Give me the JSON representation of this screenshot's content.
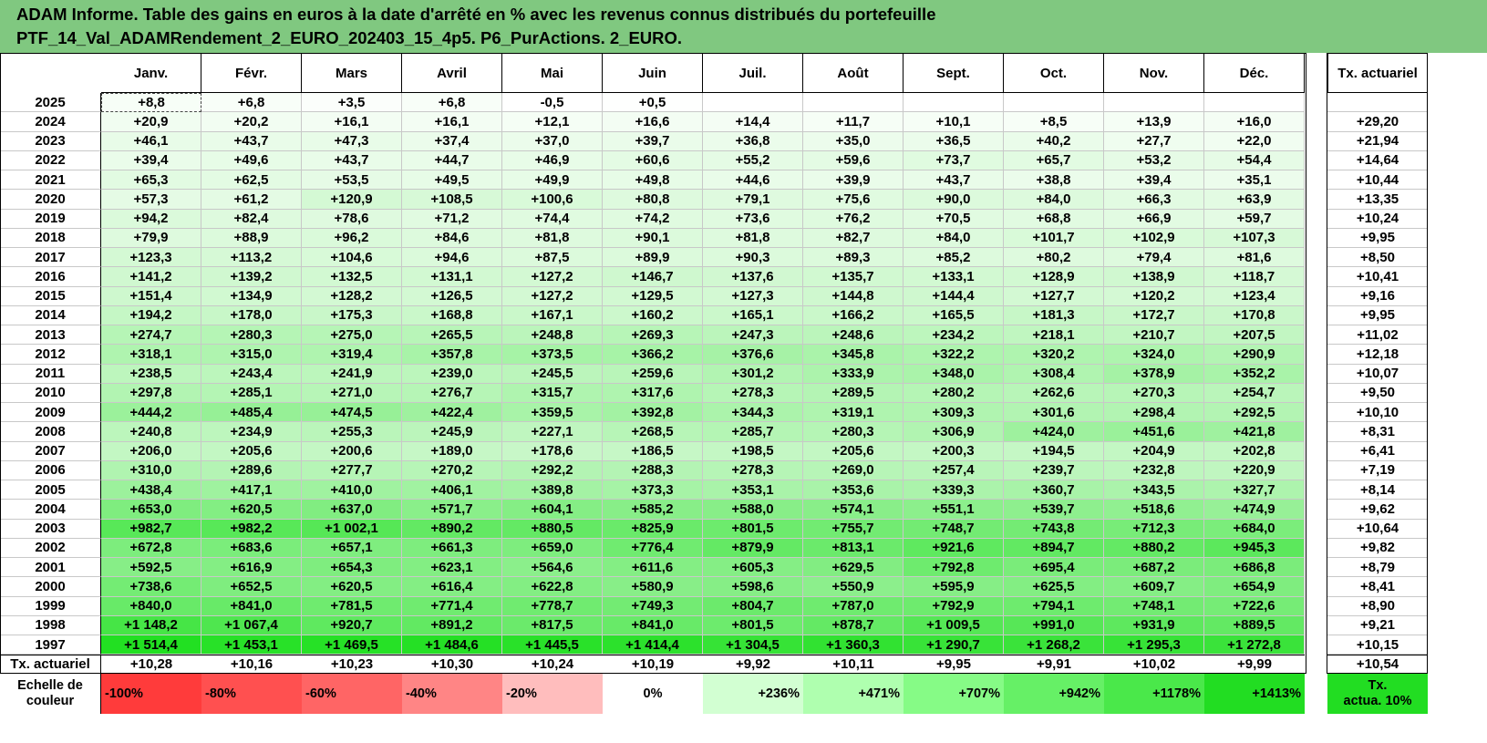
{
  "title": {
    "line1": "ADAM Informe. Table des gains en euros à la date d'arrêté en % avec les revenus connus distribués du portefeuille",
    "line2": "PTF_14_Val_ADAMRendement_2_EURO_202403_15_4p5. P6_PurActions. 2_EURO."
  },
  "months": [
    "Janv.",
    "Févr.",
    "Mars",
    "Avril",
    "Mai",
    "Juin",
    "Juil.",
    "Août",
    "Sept.",
    "Oct.",
    "Nov.",
    "Déc."
  ],
  "tx_header": "Tx. actuariel",
  "rows": [
    {
      "year": "2025",
      "vals": [
        "+8,8",
        "+6,8",
        "+3,5",
        "+6,8",
        "-0,5",
        "+0,5",
        "",
        "",
        "",
        "",
        "",
        ""
      ],
      "tx": ""
    },
    {
      "year": "2024",
      "vals": [
        "+20,9",
        "+20,2",
        "+16,1",
        "+16,1",
        "+12,1",
        "+16,6",
        "+14,4",
        "+11,7",
        "+10,1",
        "+8,5",
        "+13,9",
        "+16,0"
      ],
      "tx": "+29,20"
    },
    {
      "year": "2023",
      "vals": [
        "+46,1",
        "+43,7",
        "+47,3",
        "+37,4",
        "+37,0",
        "+39,7",
        "+36,8",
        "+35,0",
        "+36,5",
        "+40,2",
        "+27,7",
        "+22,0"
      ],
      "tx": "+21,94"
    },
    {
      "year": "2022",
      "vals": [
        "+39,4",
        "+49,6",
        "+43,7",
        "+44,7",
        "+46,9",
        "+60,6",
        "+55,2",
        "+59,6",
        "+73,7",
        "+65,7",
        "+53,2",
        "+54,4"
      ],
      "tx": "+14,64"
    },
    {
      "year": "2021",
      "vals": [
        "+65,3",
        "+62,5",
        "+53,5",
        "+49,5",
        "+49,9",
        "+49,8",
        "+44,6",
        "+39,9",
        "+43,7",
        "+38,8",
        "+39,4",
        "+35,1"
      ],
      "tx": "+10,44"
    },
    {
      "year": "2020",
      "vals": [
        "+57,3",
        "+61,2",
        "+120,9",
        "+108,5",
        "+100,6",
        "+80,8",
        "+79,1",
        "+75,6",
        "+90,0",
        "+84,0",
        "+66,3",
        "+63,9"
      ],
      "tx": "+13,35"
    },
    {
      "year": "2019",
      "vals": [
        "+94,2",
        "+82,4",
        "+78,6",
        "+71,2",
        "+74,4",
        "+74,2",
        "+73,6",
        "+76,2",
        "+70,5",
        "+68,8",
        "+66,9",
        "+59,7"
      ],
      "tx": "+10,24"
    },
    {
      "year": "2018",
      "vals": [
        "+79,9",
        "+88,9",
        "+96,2",
        "+84,6",
        "+81,8",
        "+90,1",
        "+81,8",
        "+82,7",
        "+84,0",
        "+101,7",
        "+102,9",
        "+107,3"
      ],
      "tx": "+9,95"
    },
    {
      "year": "2017",
      "vals": [
        "+123,3",
        "+113,2",
        "+104,6",
        "+94,6",
        "+87,5",
        "+89,9",
        "+90,3",
        "+89,3",
        "+85,2",
        "+80,2",
        "+79,4",
        "+81,6"
      ],
      "tx": "+8,50"
    },
    {
      "year": "2016",
      "vals": [
        "+141,2",
        "+139,2",
        "+132,5",
        "+131,1",
        "+127,2",
        "+146,7",
        "+137,6",
        "+135,7",
        "+133,1",
        "+128,9",
        "+138,9",
        "+118,7"
      ],
      "tx": "+10,41"
    },
    {
      "year": "2015",
      "vals": [
        "+151,4",
        "+134,9",
        "+128,2",
        "+126,5",
        "+127,2",
        "+129,5",
        "+127,3",
        "+144,8",
        "+144,4",
        "+127,7",
        "+120,2",
        "+123,4"
      ],
      "tx": "+9,16"
    },
    {
      "year": "2014",
      "vals": [
        "+194,2",
        "+178,0",
        "+175,3",
        "+168,8",
        "+167,1",
        "+160,2",
        "+165,1",
        "+166,2",
        "+165,5",
        "+181,3",
        "+172,7",
        "+170,8"
      ],
      "tx": "+9,95"
    },
    {
      "year": "2013",
      "vals": [
        "+274,7",
        "+280,3",
        "+275,0",
        "+265,5",
        "+248,8",
        "+269,3",
        "+247,3",
        "+248,6",
        "+234,2",
        "+218,1",
        "+210,7",
        "+207,5"
      ],
      "tx": "+11,02"
    },
    {
      "year": "2012",
      "vals": [
        "+318,1",
        "+315,0",
        "+319,4",
        "+357,8",
        "+373,5",
        "+366,2",
        "+376,6",
        "+345,8",
        "+322,2",
        "+320,2",
        "+324,0",
        "+290,9"
      ],
      "tx": "+12,18"
    },
    {
      "year": "2011",
      "vals": [
        "+238,5",
        "+243,4",
        "+241,9",
        "+239,0",
        "+245,5",
        "+259,6",
        "+301,2",
        "+333,9",
        "+348,0",
        "+308,4",
        "+378,9",
        "+352,2"
      ],
      "tx": "+10,07"
    },
    {
      "year": "2010",
      "vals": [
        "+297,8",
        "+285,1",
        "+271,0",
        "+276,7",
        "+315,7",
        "+317,6",
        "+278,3",
        "+289,5",
        "+280,2",
        "+262,6",
        "+270,3",
        "+254,7"
      ],
      "tx": "+9,50"
    },
    {
      "year": "2009",
      "vals": [
        "+444,2",
        "+485,4",
        "+474,5",
        "+422,4",
        "+359,5",
        "+392,8",
        "+344,3",
        "+319,1",
        "+309,3",
        "+301,6",
        "+298,4",
        "+292,5"
      ],
      "tx": "+10,10"
    },
    {
      "year": "2008",
      "vals": [
        "+240,8",
        "+234,9",
        "+255,3",
        "+245,9",
        "+227,1",
        "+268,5",
        "+285,7",
        "+280,3",
        "+306,9",
        "+424,0",
        "+451,6",
        "+421,8"
      ],
      "tx": "+8,31"
    },
    {
      "year": "2007",
      "vals": [
        "+206,0",
        "+205,6",
        "+200,6",
        "+189,0",
        "+178,6",
        "+186,5",
        "+198,5",
        "+205,6",
        "+200,3",
        "+194,5",
        "+204,9",
        "+202,8"
      ],
      "tx": "+6,41"
    },
    {
      "year": "2006",
      "vals": [
        "+310,0",
        "+289,6",
        "+277,7",
        "+270,2",
        "+292,2",
        "+288,3",
        "+278,3",
        "+269,0",
        "+257,4",
        "+239,7",
        "+232,8",
        "+220,9"
      ],
      "tx": "+7,19"
    },
    {
      "year": "2005",
      "vals": [
        "+438,4",
        "+417,1",
        "+410,0",
        "+406,1",
        "+389,8",
        "+373,3",
        "+353,1",
        "+353,6",
        "+339,3",
        "+360,7",
        "+343,5",
        "+327,7"
      ],
      "tx": "+8,14"
    },
    {
      "year": "2004",
      "vals": [
        "+653,0",
        "+620,5",
        "+637,0",
        "+571,7",
        "+604,1",
        "+585,2",
        "+588,0",
        "+574,1",
        "+551,1",
        "+539,7",
        "+518,6",
        "+474,9"
      ],
      "tx": "+9,62"
    },
    {
      "year": "2003",
      "vals": [
        "+982,7",
        "+982,2",
        "+1 002,1",
        "+890,2",
        "+880,5",
        "+825,9",
        "+801,5",
        "+755,7",
        "+748,7",
        "+743,8",
        "+712,3",
        "+684,0"
      ],
      "tx": "+10,64"
    },
    {
      "year": "2002",
      "vals": [
        "+672,8",
        "+683,6",
        "+657,1",
        "+661,3",
        "+659,0",
        "+776,4",
        "+879,9",
        "+813,1",
        "+921,6",
        "+894,7",
        "+880,2",
        "+945,3"
      ],
      "tx": "+9,82"
    },
    {
      "year": "2001",
      "vals": [
        "+592,5",
        "+616,9",
        "+654,3",
        "+623,1",
        "+564,6",
        "+611,6",
        "+605,3",
        "+629,5",
        "+792,8",
        "+695,4",
        "+687,2",
        "+686,8"
      ],
      "tx": "+8,79"
    },
    {
      "year": "2000",
      "vals": [
        "+738,6",
        "+652,5",
        "+620,5",
        "+616,4",
        "+622,8",
        "+580,9",
        "+598,6",
        "+550,9",
        "+595,9",
        "+625,5",
        "+609,7",
        "+654,9"
      ],
      "tx": "+8,41"
    },
    {
      "year": "1999",
      "vals": [
        "+840,0",
        "+841,0",
        "+781,5",
        "+771,4",
        "+778,7",
        "+749,3",
        "+804,7",
        "+787,0",
        "+792,9",
        "+794,1",
        "+748,1",
        "+722,6"
      ],
      "tx": "+8,90"
    },
    {
      "year": "1998",
      "vals": [
        "+1 148,2",
        "+1 067,4",
        "+920,7",
        "+891,2",
        "+817,5",
        "+841,0",
        "+801,5",
        "+878,7",
        "+1 009,5",
        "+991,0",
        "+931,9",
        "+889,5"
      ],
      "tx": "+9,21"
    },
    {
      "year": "1997",
      "vals": [
        "+1 514,4",
        "+1 453,1",
        "+1 469,5",
        "+1 484,6",
        "+1 445,5",
        "+1 414,4",
        "+1 304,5",
        "+1 360,3",
        "+1 290,7",
        "+1 268,2",
        "+1 295,3",
        "+1 272,8"
      ],
      "tx": "+10,15"
    }
  ],
  "footer": {
    "label": "Tx. actuariel",
    "vals": [
      "+10,28",
      "+10,16",
      "+10,23",
      "+10,30",
      "+10,24",
      "+10,19",
      "+9,92",
      "+10,11",
      "+9,95",
      "+9,91",
      "+10,02",
      "+9,99"
    ],
    "tx": "+10,54"
  },
  "scale": {
    "label_line1": "Echelle de",
    "label_line2": "couleur",
    "items": [
      "-100%",
      "-80%",
      "-60%",
      "-40%",
      "-20%",
      "0%",
      "+236%",
      "+471%",
      "+707%",
      "+942%",
      "+1178%",
      "+1413%"
    ],
    "colors": [
      "#FF3B3B",
      "#FF5050",
      "#FF6565",
      "#FF8585",
      "#FFBDBD",
      "#FFFFFF",
      "#D2FFD2",
      "#AFFFAF",
      "#86FB86",
      "#66F066",
      "#4AE84A",
      "#22DD22"
    ],
    "legend_line1": "Tx.",
    "legend_line2": "actua. 10%",
    "legend_color": "#22DD22"
  },
  "colors": {
    "title_bg": "#80C880",
    "max_green": "#22E022",
    "gridline": "#C8C8C8"
  }
}
